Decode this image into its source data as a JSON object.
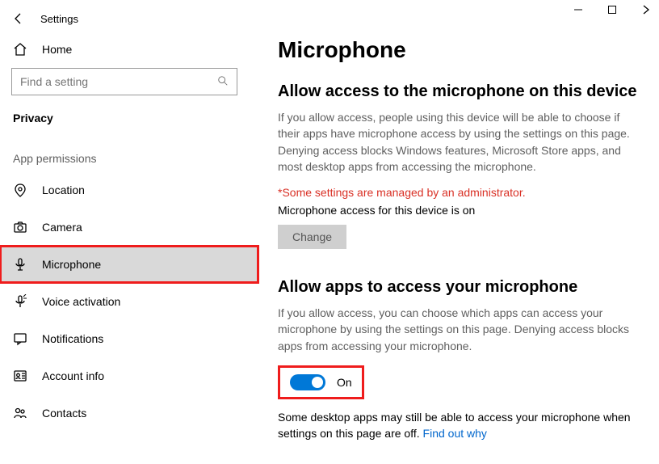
{
  "app": {
    "title": "Settings"
  },
  "sidebar": {
    "home_label": "Home",
    "search_placeholder": "Find a setting",
    "section_label": "Privacy",
    "group_label": "App permissions",
    "items": [
      {
        "label": "Location"
      },
      {
        "label": "Camera"
      },
      {
        "label": "Microphone"
      },
      {
        "label": "Voice activation"
      },
      {
        "label": "Notifications"
      },
      {
        "label": "Account info"
      },
      {
        "label": "Contacts"
      }
    ]
  },
  "main": {
    "heading": "Microphone",
    "device_heading": "Allow access to the microphone on this device",
    "device_desc": "If you allow access, people using this device will be able to choose if their apps have microphone access by using the settings on this page. Denying access blocks Windows features, Microsoft Store apps, and most desktop apps from accessing the microphone.",
    "admin_notice": "*Some settings are managed by an administrator.",
    "device_status": "Microphone access for this device is on",
    "change_label": "Change",
    "apps_heading": "Allow apps to access your microphone",
    "apps_desc": "If you allow access, you can choose which apps can access your microphone by using the settings on this page. Denying access blocks apps from accessing your microphone.",
    "toggle_label": "On",
    "footnote_text": "Some desktop apps may still be able to access your microphone when settings on this page are off. ",
    "footnote_link": "Find out why"
  }
}
